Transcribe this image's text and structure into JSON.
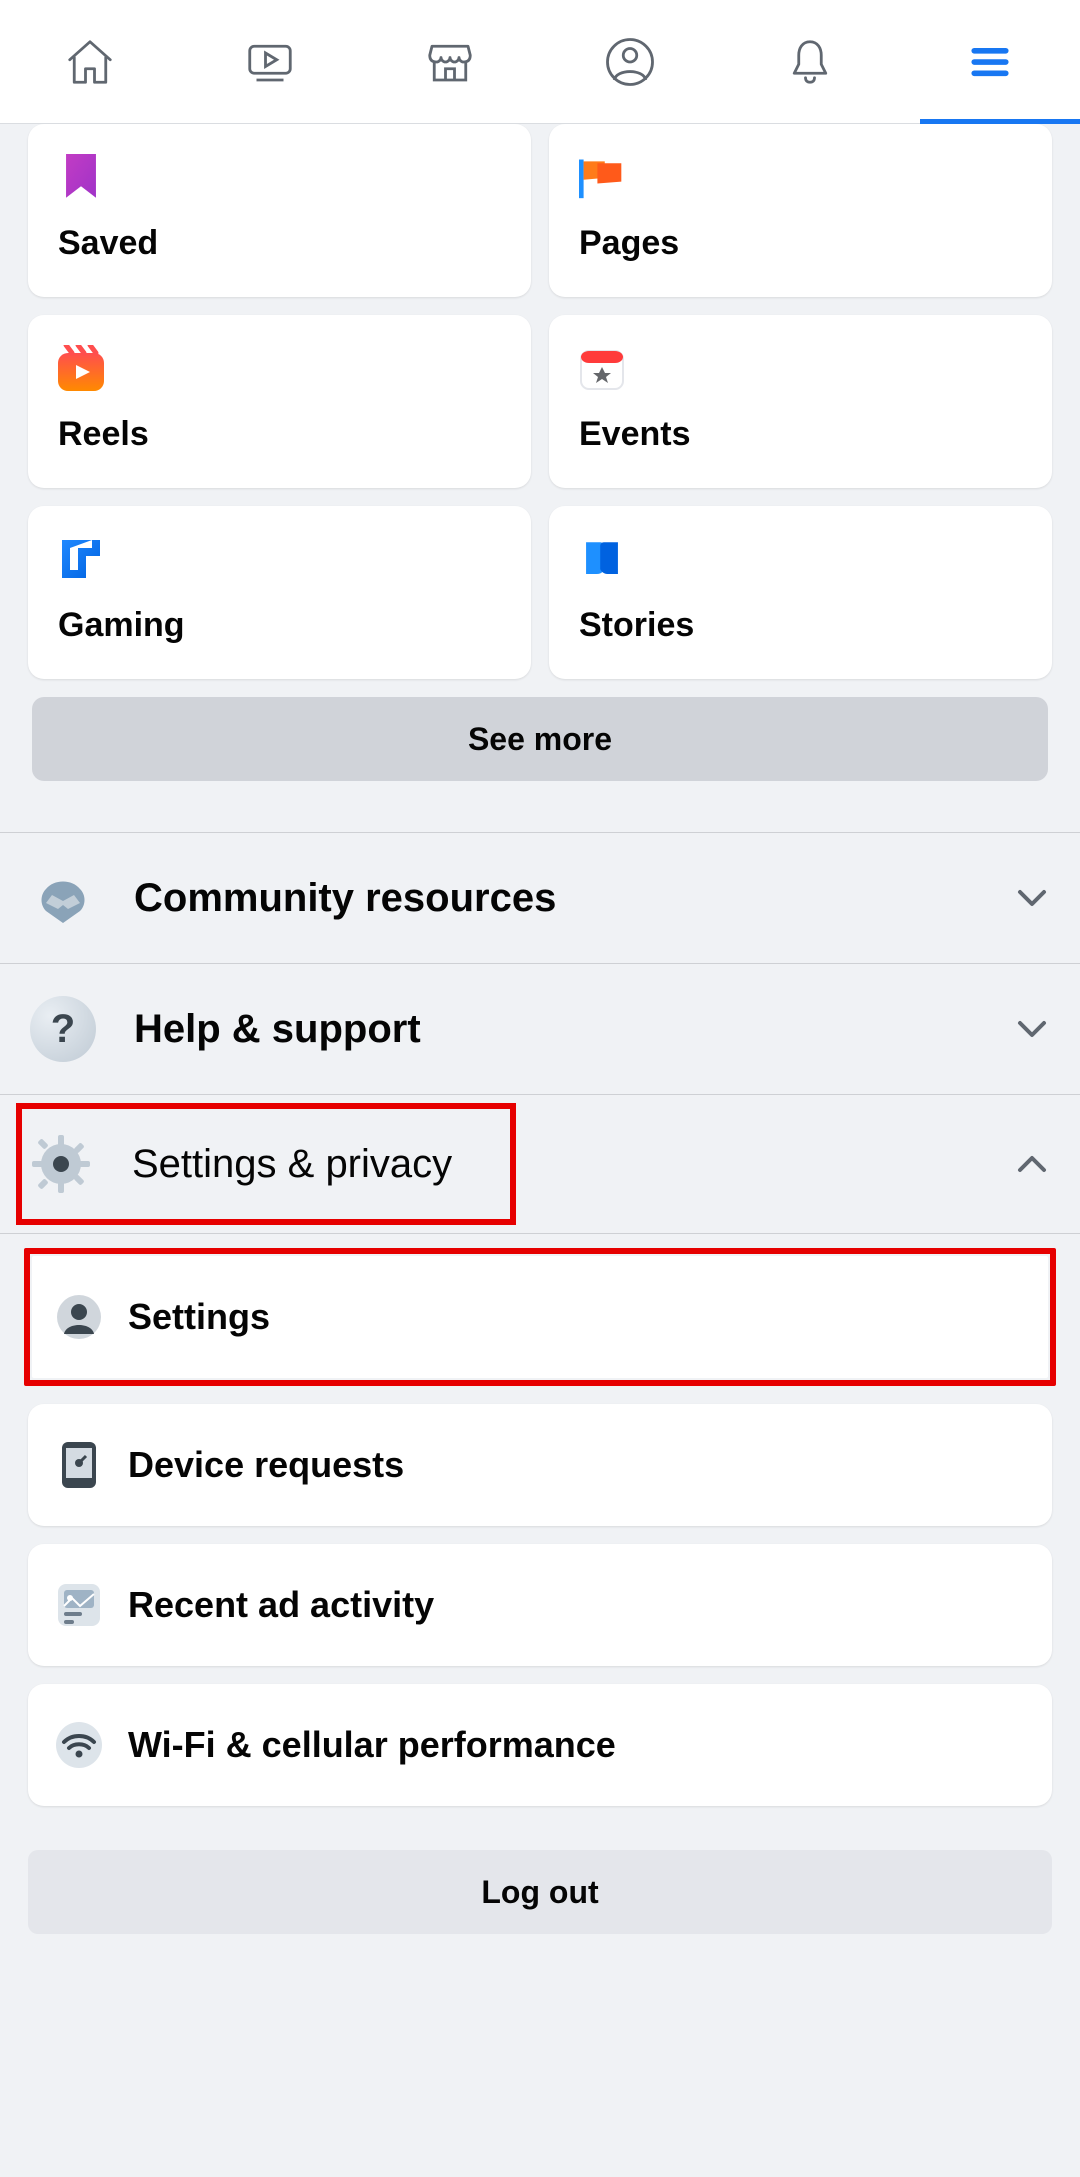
{
  "nav": {
    "tabs": [
      "Home",
      "Video",
      "Marketplace",
      "Profile",
      "Notifications",
      "Menu"
    ],
    "activeIndex": 5
  },
  "shortcuts": [
    {
      "key": "saved",
      "label": "Saved"
    },
    {
      "key": "pages",
      "label": "Pages"
    },
    {
      "key": "reels",
      "label": "Reels"
    },
    {
      "key": "events",
      "label": "Events"
    },
    {
      "key": "gaming",
      "label": "Gaming"
    },
    {
      "key": "stories",
      "label": "Stories"
    }
  ],
  "seeMore": "See more",
  "sections": {
    "community": {
      "label": "Community resources",
      "expanded": false
    },
    "help": {
      "label": "Help & support",
      "expanded": false
    },
    "settingsPrivacy": {
      "label": "Settings & privacy",
      "expanded": true
    }
  },
  "settingsItems": [
    {
      "key": "settings",
      "label": "Settings"
    },
    {
      "key": "deviceRequests",
      "label": "Device requests"
    },
    {
      "key": "recentAdActivity",
      "label": "Recent ad activity"
    },
    {
      "key": "wifiCellPerf",
      "label": "Wi-Fi & cellular performance"
    }
  ],
  "logout": "Log out",
  "highlights": {
    "settingsPrivacyHeader": true,
    "settingsItem": true
  }
}
